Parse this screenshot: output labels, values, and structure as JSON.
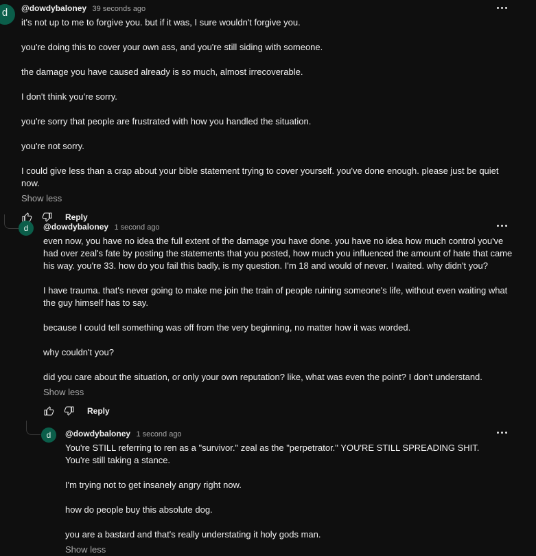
{
  "comments": [
    {
      "author": "@dowdybaloney",
      "time": "39 seconds ago",
      "avatar_letter": "d",
      "paragraphs": [
        "it's not up to me to forgive you. but if it was, I sure wouldn't forgive you.",
        "you're doing this to cover your own ass, and you're still siding with someone.",
        "the damage you have caused already is so much, almost irrecoverable.",
        "I don't think you're sorry.",
        "you're sorry that people are frustrated with how you handled the situation.",
        "you're not sorry.",
        "I could give less than a crap about your bible statement trying to cover yourself. you've done enough. please just be quiet now."
      ],
      "show_less": "Show less",
      "reply": "Reply"
    },
    {
      "author": "@dowdybaloney",
      "time": "1 second ago",
      "avatar_letter": "d",
      "paragraphs": [
        "even now, you have no idea the full extent of the damage you have done. you have no idea how much control you've had over zeal's fate by posting the statements that you posted, how much you influenced the amount of hate that came his way. you're 33. how do you fail this badly, is my question. I'm 18 and would of never. I waited. why didn't you?",
        "I have trauma. that's never going to make me join the train of people ruining someone's life, without even waiting what the guy himself has to say.",
        "because I could tell something was off from the very beginning, no matter how it was worded.",
        "why couldn't you?",
        "did you care about the situation, or only your own reputation? like, what was even the point? I don't understand."
      ],
      "show_less": "Show less",
      "reply": "Reply"
    },
    {
      "author": "@dowdybaloney",
      "time": "1 second ago",
      "avatar_letter": "d",
      "paragraphs": [
        "You're STILL referring to ren as a \"survivor.\" zeal as the \"perpetrator.\" YOU'RE STILL SPREADING SHIT. You're still taking a stance.",
        "I'm trying not to get insanely angry right now.",
        "how do people buy this absolute dog.",
        "you are a bastard and that's really understating it holy gods man."
      ],
      "show_less": "Show less"
    }
  ],
  "colors": {
    "background": "#0f0f0f",
    "avatar": "#0b5e4a",
    "text": "#f1f1f1",
    "muted": "#aaaaaa"
  },
  "icons": {
    "like": "thumbs-up-icon",
    "dislike": "thumbs-down-icon",
    "more": "more-vert-icon"
  }
}
